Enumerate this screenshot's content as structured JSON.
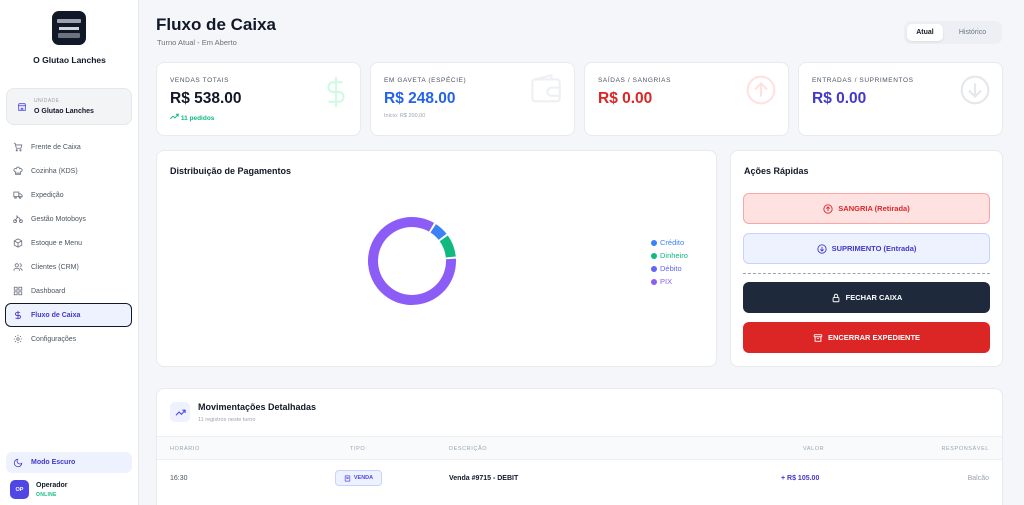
{
  "sidebar": {
    "brand": "O Glutao Lanches",
    "unit": {
      "caption": "UNIDADE",
      "name": "O Glutao Lanches"
    },
    "items": [
      {
        "label": "Frente de Caixa",
        "icon": "cart-icon"
      },
      {
        "label": "Cozinha (KDS)",
        "icon": "chef-hat-icon"
      },
      {
        "label": "Expedição",
        "icon": "truck-icon"
      },
      {
        "label": "Gestão Motoboys",
        "icon": "bike-icon"
      },
      {
        "label": "Estoque e Menu",
        "icon": "box-icon"
      },
      {
        "label": "Clientes (CRM)",
        "icon": "users-icon"
      },
      {
        "label": "Dashboard",
        "icon": "grid-icon"
      },
      {
        "label": "Fluxo de Caixa",
        "icon": "dollar-icon",
        "active": true
      },
      {
        "label": "Configurações",
        "icon": "gear-icon"
      }
    ],
    "dark_mode": "Modo Escuro",
    "operator": {
      "initials": "OP",
      "name": "Operador",
      "status": "ONLINE"
    }
  },
  "header": {
    "title": "Fluxo de Caixa",
    "subtitle": "Turno Atual - Em Aberto",
    "tabs": [
      "Atual",
      "Histórico"
    ]
  },
  "stats": [
    {
      "label": "VENDAS TOTAIS",
      "value": "R$ 538.00",
      "sub": "11 pedidos",
      "color": "#111827"
    },
    {
      "label": "EM GAVETA (ESPÉCIE)",
      "value": "R$ 248.00",
      "sub": "Inicio: R$ 200.00",
      "color": "#2563eb"
    },
    {
      "label": "SAÍDAS / SANGRIAS",
      "value": "R$ 0.00",
      "sub": "",
      "color": "#dc2626"
    },
    {
      "label": "ENTRADAS / SUPRIMENTOS",
      "value": "R$ 0.00",
      "sub": "",
      "color": "#4338ca"
    }
  ],
  "payments": {
    "title": "Distribuição de Pagamentos",
    "chart_data": {
      "type": "pie",
      "variant": "donut",
      "categories": [
        "Crédito",
        "Dinheiro",
        "Débito",
        "PIX"
      ],
      "values": [
        6,
        9,
        0,
        85
      ],
      "unit": "percent",
      "colors": [
        "#3b82f6",
        "#10b981",
        "#6366f1",
        "#8b5cf6"
      ],
      "legend": "right"
    }
  },
  "quick": {
    "title": "Ações Rápidas",
    "sangria": "SANGRIA (Retirada)",
    "suprimento": "SUPRIMENTO (Entrada)",
    "fechar": "FECHAR CAIXA",
    "encerrar": "ENCERRAR EXPEDIENTE"
  },
  "movements": {
    "title": "Movimentações Detalhadas",
    "subtitle": "11 registros neste turno",
    "columns": [
      "HORÁRIO",
      "TIPO",
      "DESCRIÇÃO",
      "VALOR",
      "RESPONSÁVEL"
    ],
    "rows": [
      {
        "time": "16:30",
        "type": "VENDA",
        "description": "Venda #9715 - DEBIT",
        "value": "+ R$ 105.00",
        "responsible": "Balcão"
      }
    ]
  }
}
